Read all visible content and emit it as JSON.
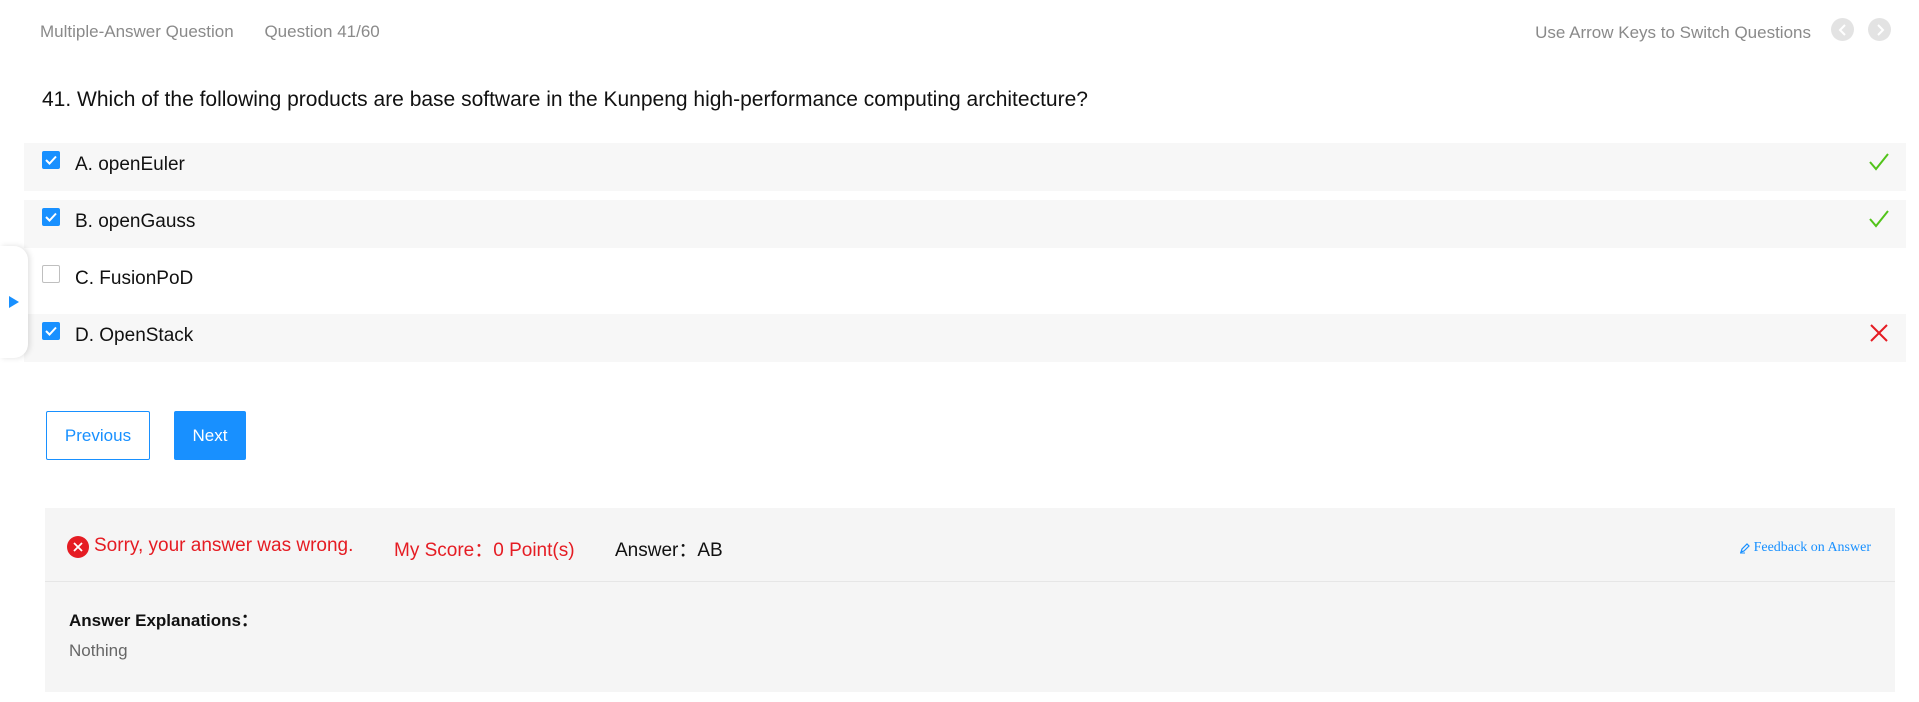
{
  "header": {
    "question_type": "Multiple-Answer Question",
    "question_progress": "Question 41/60",
    "hint": "Use Arrow Keys to Switch Questions",
    "prev_icon": "chevron-left-icon",
    "next_icon": "chevron-right-icon"
  },
  "question": {
    "text": "41. Which of the following products are base software in the Kunpeng high-performance computing architecture?"
  },
  "options": [
    {
      "label": "A. openEuler",
      "checked": true,
      "result": "correct"
    },
    {
      "label": "B. openGauss",
      "checked": true,
      "result": "correct"
    },
    {
      "label": "C. FusionPoD",
      "checked": false,
      "result": "none"
    },
    {
      "label": "D. OpenStack",
      "checked": true,
      "result": "wrong"
    }
  ],
  "buttons": {
    "previous": "Previous",
    "next": "Next"
  },
  "result": {
    "status": "Sorry, your answer was wrong.",
    "score": "My Score：0 Point(s)",
    "answer": "Answer：AB",
    "feedback": "Feedback on Answer",
    "explanation_title": "Answer Explanations：",
    "explanation_body": "Nothing"
  },
  "colors": {
    "accent": "#1890ff",
    "correct": "#52c41a",
    "wrong": "#e51c23"
  }
}
